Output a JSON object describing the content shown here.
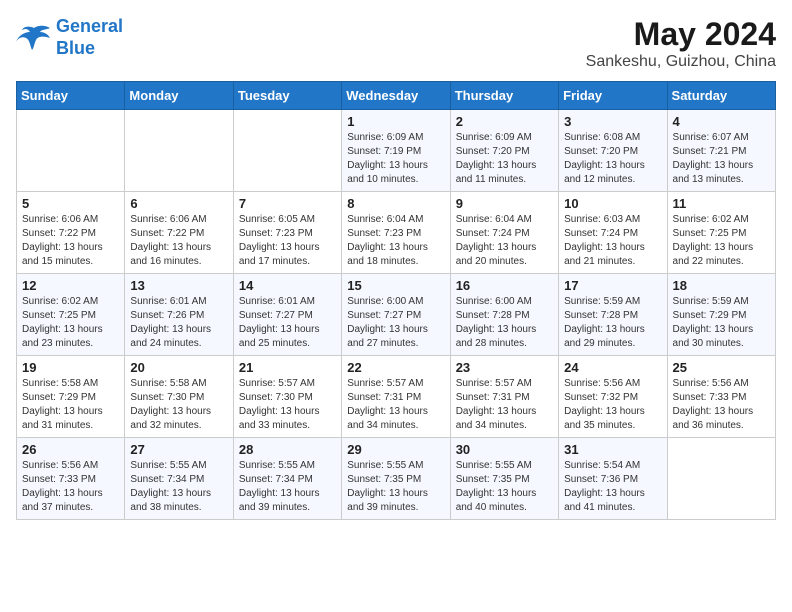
{
  "logo": {
    "line1": "General",
    "line2": "Blue"
  },
  "title": "May 2024",
  "subtitle": "Sankeshu, Guizhou, China",
  "days_of_week": [
    "Sunday",
    "Monday",
    "Tuesday",
    "Wednesday",
    "Thursday",
    "Friday",
    "Saturday"
  ],
  "weeks": [
    [
      {
        "day": "",
        "info": ""
      },
      {
        "day": "",
        "info": ""
      },
      {
        "day": "",
        "info": ""
      },
      {
        "day": "1",
        "info": "Sunrise: 6:09 AM\nSunset: 7:19 PM\nDaylight: 13 hours\nand 10 minutes."
      },
      {
        "day": "2",
        "info": "Sunrise: 6:09 AM\nSunset: 7:20 PM\nDaylight: 13 hours\nand 11 minutes."
      },
      {
        "day": "3",
        "info": "Sunrise: 6:08 AM\nSunset: 7:20 PM\nDaylight: 13 hours\nand 12 minutes."
      },
      {
        "day": "4",
        "info": "Sunrise: 6:07 AM\nSunset: 7:21 PM\nDaylight: 13 hours\nand 13 minutes."
      }
    ],
    [
      {
        "day": "5",
        "info": "Sunrise: 6:06 AM\nSunset: 7:22 PM\nDaylight: 13 hours\nand 15 minutes."
      },
      {
        "day": "6",
        "info": "Sunrise: 6:06 AM\nSunset: 7:22 PM\nDaylight: 13 hours\nand 16 minutes."
      },
      {
        "day": "7",
        "info": "Sunrise: 6:05 AM\nSunset: 7:23 PM\nDaylight: 13 hours\nand 17 minutes."
      },
      {
        "day": "8",
        "info": "Sunrise: 6:04 AM\nSunset: 7:23 PM\nDaylight: 13 hours\nand 18 minutes."
      },
      {
        "day": "9",
        "info": "Sunrise: 6:04 AM\nSunset: 7:24 PM\nDaylight: 13 hours\nand 20 minutes."
      },
      {
        "day": "10",
        "info": "Sunrise: 6:03 AM\nSunset: 7:24 PM\nDaylight: 13 hours\nand 21 minutes."
      },
      {
        "day": "11",
        "info": "Sunrise: 6:02 AM\nSunset: 7:25 PM\nDaylight: 13 hours\nand 22 minutes."
      }
    ],
    [
      {
        "day": "12",
        "info": "Sunrise: 6:02 AM\nSunset: 7:25 PM\nDaylight: 13 hours\nand 23 minutes."
      },
      {
        "day": "13",
        "info": "Sunrise: 6:01 AM\nSunset: 7:26 PM\nDaylight: 13 hours\nand 24 minutes."
      },
      {
        "day": "14",
        "info": "Sunrise: 6:01 AM\nSunset: 7:27 PM\nDaylight: 13 hours\nand 25 minutes."
      },
      {
        "day": "15",
        "info": "Sunrise: 6:00 AM\nSunset: 7:27 PM\nDaylight: 13 hours\nand 27 minutes."
      },
      {
        "day": "16",
        "info": "Sunrise: 6:00 AM\nSunset: 7:28 PM\nDaylight: 13 hours\nand 28 minutes."
      },
      {
        "day": "17",
        "info": "Sunrise: 5:59 AM\nSunset: 7:28 PM\nDaylight: 13 hours\nand 29 minutes."
      },
      {
        "day": "18",
        "info": "Sunrise: 5:59 AM\nSunset: 7:29 PM\nDaylight: 13 hours\nand 30 minutes."
      }
    ],
    [
      {
        "day": "19",
        "info": "Sunrise: 5:58 AM\nSunset: 7:29 PM\nDaylight: 13 hours\nand 31 minutes."
      },
      {
        "day": "20",
        "info": "Sunrise: 5:58 AM\nSunset: 7:30 PM\nDaylight: 13 hours\nand 32 minutes."
      },
      {
        "day": "21",
        "info": "Sunrise: 5:57 AM\nSunset: 7:30 PM\nDaylight: 13 hours\nand 33 minutes."
      },
      {
        "day": "22",
        "info": "Sunrise: 5:57 AM\nSunset: 7:31 PM\nDaylight: 13 hours\nand 34 minutes."
      },
      {
        "day": "23",
        "info": "Sunrise: 5:57 AM\nSunset: 7:31 PM\nDaylight: 13 hours\nand 34 minutes."
      },
      {
        "day": "24",
        "info": "Sunrise: 5:56 AM\nSunset: 7:32 PM\nDaylight: 13 hours\nand 35 minutes."
      },
      {
        "day": "25",
        "info": "Sunrise: 5:56 AM\nSunset: 7:33 PM\nDaylight: 13 hours\nand 36 minutes."
      }
    ],
    [
      {
        "day": "26",
        "info": "Sunrise: 5:56 AM\nSunset: 7:33 PM\nDaylight: 13 hours\nand 37 minutes."
      },
      {
        "day": "27",
        "info": "Sunrise: 5:55 AM\nSunset: 7:34 PM\nDaylight: 13 hours\nand 38 minutes."
      },
      {
        "day": "28",
        "info": "Sunrise: 5:55 AM\nSunset: 7:34 PM\nDaylight: 13 hours\nand 39 minutes."
      },
      {
        "day": "29",
        "info": "Sunrise: 5:55 AM\nSunset: 7:35 PM\nDaylight: 13 hours\nand 39 minutes."
      },
      {
        "day": "30",
        "info": "Sunrise: 5:55 AM\nSunset: 7:35 PM\nDaylight: 13 hours\nand 40 minutes."
      },
      {
        "day": "31",
        "info": "Sunrise: 5:54 AM\nSunset: 7:36 PM\nDaylight: 13 hours\nand 41 minutes."
      },
      {
        "day": "",
        "info": ""
      }
    ]
  ]
}
